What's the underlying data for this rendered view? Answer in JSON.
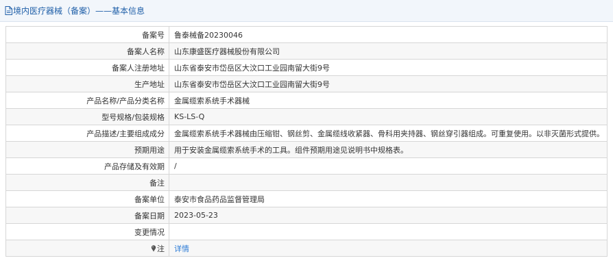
{
  "header": {
    "title": "境内医疗器械（备案）——基本信息",
    "icon": "document-icon",
    "color": "#1f5fa8"
  },
  "rows": [
    {
      "label": "备案号",
      "value": "鲁泰械备20230046"
    },
    {
      "label": "备案人名称",
      "value": "山东康盛医疗器械股份有限公司"
    },
    {
      "label": "备案人注册地址",
      "value": "山东省泰安市岱岳区大汶口工业园南留大街9号"
    },
    {
      "label": "生产地址",
      "value": "山东省泰安市岱岳区大汶口工业园南留大街9号"
    },
    {
      "label": "产品名称/产品分类名称",
      "value": "金属缆索系统手术器械"
    },
    {
      "label": "型号规格/包装规格",
      "value": "KS-LS-Q"
    },
    {
      "label": "产品描述/主要组成成分",
      "value": "金属缆索系统手术器械由压缩钳、钢丝剪、金属缆线收紧器、骨科用夹持器、钢丝穿引器组成。可重复使用。以非灭菌形式提供。"
    },
    {
      "label": "预期用途",
      "value": "用于安装金属缆索系统手术的工具。组件预期用途见说明书中规格表。"
    },
    {
      "label": "产品存储及有效期",
      "value": "/"
    },
    {
      "label": "备注",
      "value": ""
    },
    {
      "label": "备案单位",
      "value": "泰安市食品药品监督管理局"
    },
    {
      "label": "备案日期",
      "value": "2023-05-23"
    },
    {
      "label": "变更情况",
      "value": ""
    }
  ],
  "note_row": {
    "label": "注",
    "icon": "pin-icon",
    "link_text": "详情",
    "link_color": "#2a7ad6"
  }
}
